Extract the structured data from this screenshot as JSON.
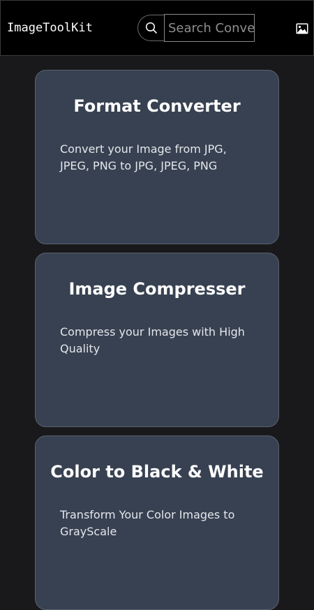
{
  "header": {
    "brand": "ImageToolKit",
    "search_placeholder": "Search Converter",
    "search_icon": "search-icon",
    "image_icon": "image-icon"
  },
  "cards": [
    {
      "title": "Format Converter",
      "description": "Convert your Image from JPG, JPEG, PNG to JPG, JPEG, PNG"
    },
    {
      "title": "Image Compresser",
      "description": "Compress your Images with High Quality"
    },
    {
      "title": "Color to Black & White",
      "description": "Transform Your Color Images to GrayScale"
    }
  ],
  "colors": {
    "page_bg": "#19191b",
    "nav_bg": "#000000",
    "card_bg": "#374151",
    "text": "#ffffff"
  }
}
